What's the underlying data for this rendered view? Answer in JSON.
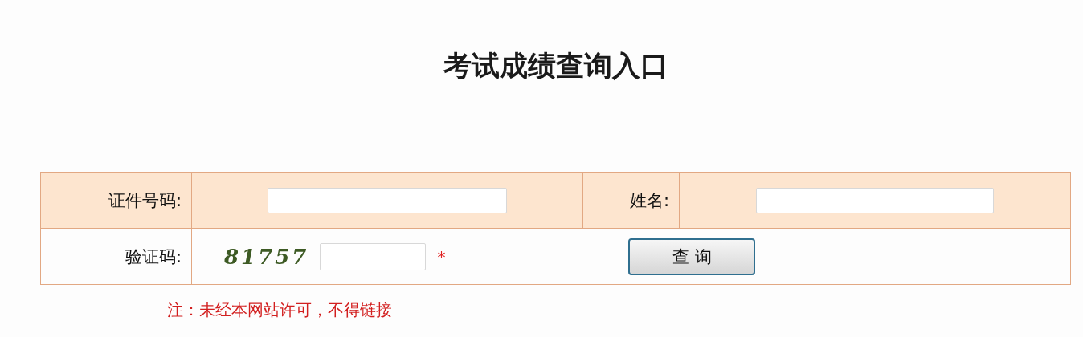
{
  "title": "考试成绩查询入口",
  "form": {
    "id_label": "证件号码:",
    "name_label": "姓名:",
    "captcha_label": "验证码:",
    "captcha_code": "81757",
    "required_mark": "*",
    "submit": "查 询"
  },
  "note": "注：未经本网站许可，不得链接"
}
